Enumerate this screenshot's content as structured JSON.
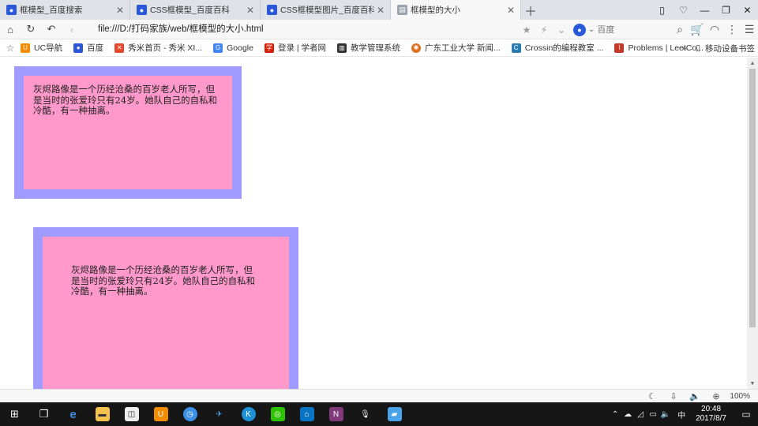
{
  "tabs": [
    {
      "label": "框模型_百度搜索",
      "icon": "baidu-paw-icon"
    },
    {
      "label": "CSS框模型_百度百科",
      "icon": "baidu-paw-icon"
    },
    {
      "label": "CSS框模型图片_百度百科",
      "icon": "baidu-paw-icon"
    },
    {
      "label": "框模型的大小",
      "icon": "page-icon"
    }
  ],
  "address": {
    "url": "file:///D:/打码家族/web/框模型的大小.html"
  },
  "search": {
    "engine_label": "百度"
  },
  "bookmarks": [
    {
      "label": "UC导航",
      "color": "#f28c00",
      "icon": "uc-icon"
    },
    {
      "label": "百度",
      "color": "#2b57d9",
      "icon": "baidu-paw-icon"
    },
    {
      "label": "秀米首页 - 秀米 XI...",
      "color": "#e64a2e",
      "icon": "xiumi-icon"
    },
    {
      "label": "Google",
      "color": "#4285f4",
      "icon": "google-icon"
    },
    {
      "label": "登录 | 学者网",
      "color": "#d81e06",
      "icon": "scholar-icon"
    },
    {
      "label": "教学管理系统",
      "color": "#333333",
      "icon": "building-icon"
    },
    {
      "label": "广东工业大学 新闻...",
      "color": "#e07020",
      "icon": "gdut-icon"
    },
    {
      "label": "Crossin的编程教室 ...",
      "color": "#2a7ab0",
      "icon": "crossin-icon"
    },
    {
      "label": "Problems | LeetCo...",
      "color": "#c0392b",
      "icon": "leetcode-icon"
    }
  ],
  "bookmarks_more": "»",
  "mobile_bookmarks": "移动设备书签",
  "boxes": [
    {
      "text": "灰烬路像是一个历经沧桑的百岁老人所写，但是当时的张爱玲只有24岁。她队自己的自私和冷酷，有一种抽离。"
    },
    {
      "text": "灰烬路像是一个历经沧桑的百岁老人所写，但是当时的张爱玲只有24岁。她队自己的自私和冷酷，有一种抽离。"
    }
  ],
  "colors": {
    "border": "#a09cff",
    "fill": "#ff99cc"
  },
  "status": {
    "zoom": "100%"
  },
  "taskbar": {
    "ime": "中",
    "time": "20:48",
    "date": "2017/8/7"
  }
}
